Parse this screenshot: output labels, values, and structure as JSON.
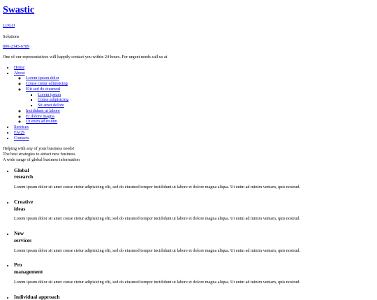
{
  "header": {
    "brand": "Swastic",
    "logo_alt": "LOGO",
    "solutions": "Solutions",
    "phone": "800-2345-6789",
    "contact_note": "One of our representatives will happily contact you within 24 hours. For urgent needs call us at"
  },
  "nav": {
    "home": "Home",
    "about": "About",
    "about_sub": {
      "lorem": "Lorem ipsum dolor",
      "conse": "Conse ctetur adipisicing",
      "elit": "Elit sed do eiusmod",
      "elit_sub": {
        "lorem": "Lorem ipsum",
        "conse": "Conse adipisicing",
        "sit": "Sit amet dolore"
      },
      "incididunt": "Incididunt ut labore",
      "et_dolore": "Et dolore magna",
      "ut_enim": "Ut enim ad minim"
    },
    "services": "Services",
    "faqs": "FAQS",
    "contacts": "Contacts"
  },
  "taglines": {
    "line1": "Helping with any of your business needs!",
    "line2": "The best strategies to attract new business",
    "line3": "A wide range of global business information"
  },
  "features": [
    {
      "title_line1": "Global",
      "title_line2": "research",
      "desc": "Lorem ipsum dolor sit amet conse ctetur adipisicing elit, sed do eiusmod tempor incididunt ut labore et dolore magna aliqua. Ut enim ad minim veniam, quis nostrud."
    },
    {
      "title_line1": "Creative",
      "title_line2": "ideas",
      "desc": "Lorem ipsum dolor sit amet conse ctetur adipisicing elit, sed do eiusmod tempor incididunt ut labore et dolore magna aliqua. Ut enim ad minim veniam, quis nostrud."
    },
    {
      "title_line1": "New",
      "title_line2": "services",
      "desc": "Lorem ipsum dolor sit amet conse ctetur adipisicing elit, sed do eiusmod tempor incididunt ut labore et dolore magna aliqua. Ut enim ad minim veniam, quis nostrud."
    },
    {
      "title_line1": "Pro",
      "title_line2": "management",
      "desc": "Lorem ipsum dolor sit amet conse ctetur adipisicing elit, sed do eiusmod tempor incididunt ut labore et dolore magna aliqua. Ut enim ad minim veniam, quis nostrud."
    }
  ],
  "cutoff_heading": "Individual approach"
}
